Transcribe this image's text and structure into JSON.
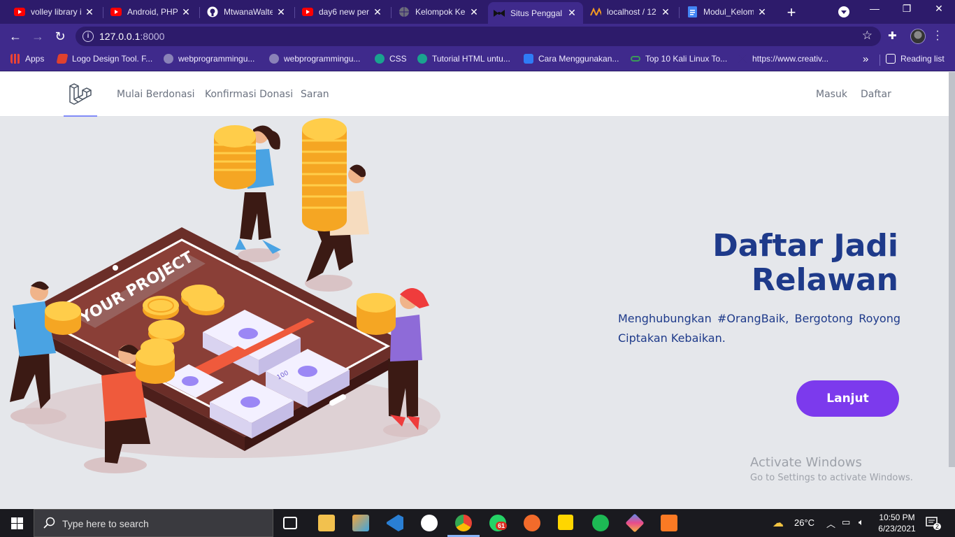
{
  "browser": {
    "tabs": [
      {
        "title": "volley library i",
        "icon": "youtube-icon"
      },
      {
        "title": "Android, PHP",
        "icon": "youtube-icon"
      },
      {
        "title": "MtwanaWalte",
        "icon": "github-icon"
      },
      {
        "title": "day6 new per",
        "icon": "youtube-icon"
      },
      {
        "title": "Kelompok Kel",
        "icon": "globe-icon"
      },
      {
        "title": "Situs Penggal",
        "icon": "bowtie-icon",
        "active": true
      },
      {
        "title": "localhost / 12",
        "icon": "phpmyadmin-icon"
      },
      {
        "title": "Modul_Kelom",
        "icon": "docs-icon"
      }
    ],
    "url_host": "127.0.0.1",
    "url_port": ":8000",
    "bookmarks": [
      {
        "label": "Apps"
      },
      {
        "label": "Logo Design Tool. F..."
      },
      {
        "label": "webprogrammingu..."
      },
      {
        "label": "webprogrammingu..."
      },
      {
        "label": "CSS"
      },
      {
        "label": "Tutorial HTML untu..."
      },
      {
        "label": "Cara Menggunakan..."
      },
      {
        "label": "Top 10 Kali Linux To..."
      },
      {
        "label": "https://www.creativ..."
      }
    ],
    "bookmarks_more": "»",
    "reading_list": "Reading list"
  },
  "nav": {
    "links": [
      "Mulai Berdonasi",
      "Konfirmasi Donasi",
      "Saran"
    ],
    "login": "Masuk",
    "register": "Daftar"
  },
  "hero": {
    "title_line1": "Daftar Jadi",
    "title_line2": "Relawan",
    "subtitle": "Menghubungkan #OrangBaik, Bergotong Royong Ciptakan Kebaikan.",
    "cta": "Lanjut",
    "illustration_text": "YOUR PROJECT",
    "banknote_value": "100"
  },
  "watermark": {
    "line1": "Activate Windows",
    "line2": "Go to Settings to activate Windows."
  },
  "taskbar": {
    "search_placeholder": "Type here to search",
    "weather": "26°C",
    "time": "10:50 PM",
    "date": "6/23/2021",
    "whatsapp_badge": "61",
    "notifications": "2"
  },
  "colors": {
    "chrome_frame": "#2d1b6b",
    "chrome_toolbar": "#3f2a8c",
    "hero_title": "#1e3a8a",
    "cta_bg": "#7c3aed",
    "page_bg": "#e5e7eb"
  }
}
